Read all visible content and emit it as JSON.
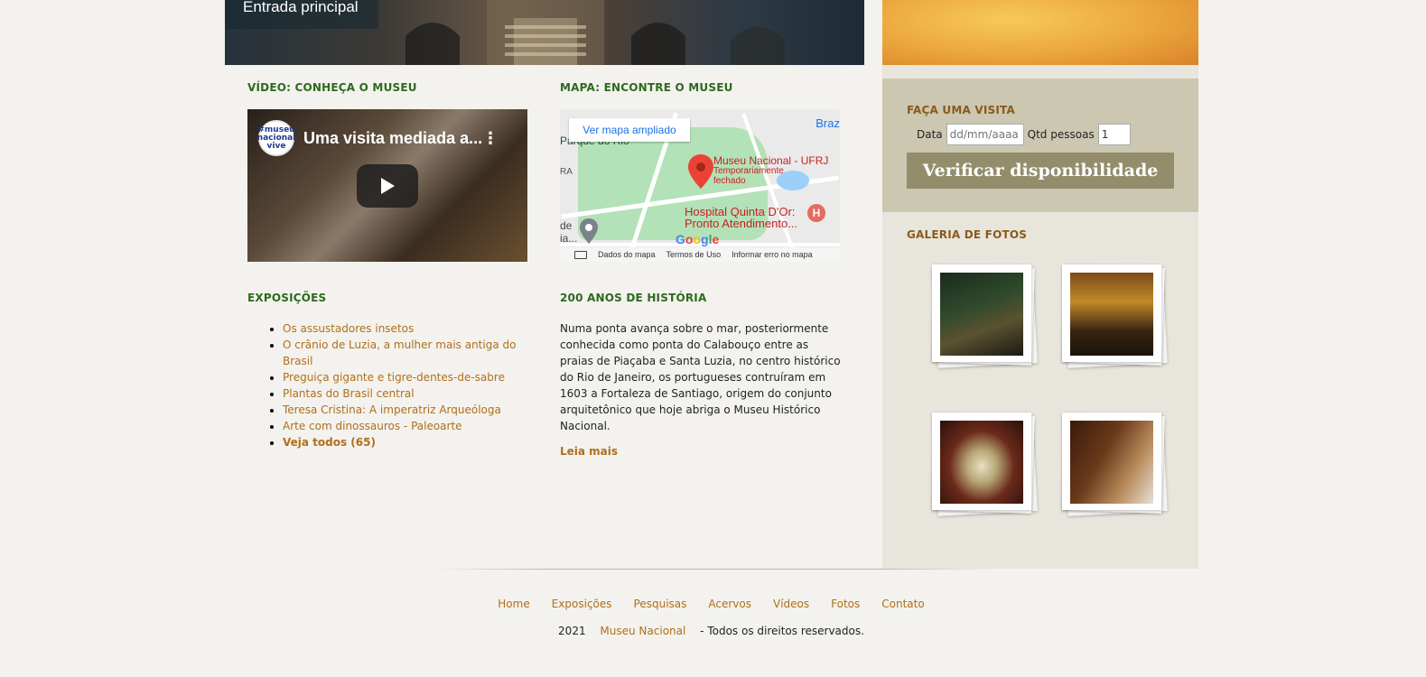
{
  "hero": {
    "caption": "Entrada principal"
  },
  "video": {
    "section_title": "VÍDEO: CONHEÇA O MUSEU",
    "channel_logo_text": "#museu nacional vive",
    "title": "Uma visita mediada a...",
    "menu_icon": "more-vert-icon",
    "play_icon": "play-icon"
  },
  "map": {
    "section_title": "MAPA: ENCONTRE O MUSEU",
    "open_larger": "Ver mapa ampliado",
    "labels": {
      "braz": "Braz",
      "park": "Parque do Rio",
      "ra": "RA",
      "museum": "Museu Nacional - UFRJ",
      "museum_status_1": "Temporariamente",
      "museum_status_2": "fechado",
      "hospital_1": "Hospital Quinta D'Or:",
      "hospital_2": "Pronto Atendimento...",
      "dia_1": "de",
      "dia_2": "ia..."
    },
    "google_logo": "Google",
    "footer": {
      "map_data": "Dados do mapa",
      "terms": "Termos de Uso",
      "report": "Informar erro no mapa"
    },
    "colors": {
      "park": "#b3e1b8",
      "pin": "#ea4335",
      "link": "#1a73e8"
    }
  },
  "exposicoes": {
    "section_title": "EXPOSIÇÕES",
    "items": [
      "Os assustadores insetos",
      "O crânio de Luzia, a mulher mais antiga do Brasil",
      "Preguiça gigante e tigre-dentes-de-sabre",
      "Plantas do Brasil central",
      "Teresa Cristina: A imperatriz Arqueóloga",
      "Arte com dinossauros - Paleoarte"
    ],
    "see_all": "Veja todos (65)"
  },
  "historia": {
    "section_title": "200 ANOS DE HISTÓRIA",
    "text": "Numa ponta avança sobre o mar, posteriormente conhecida como ponta do Calabouço entre as praias de Piaçaba e Santa Luzia, no centro histórico do Rio de Janeiro, os portugueses contruíram em 1603 a Fortaleza de Santiago, origem do conjunto arquitetônico que hoje abriga o Museu Histórico Nacional.",
    "read_more": "Leia mais"
  },
  "visita": {
    "title": "FAÇA UMA VISITA",
    "date_label": "Data",
    "date_placeholder": "dd/mm/aaaa",
    "qty_label": "Qtd pessoas",
    "qty_value": "1",
    "button": "Verificar disponibilidade"
  },
  "galeria": {
    "title": "GALERIA DE FOTOS",
    "photo_count": 4
  },
  "footer": {
    "nav": [
      "Home",
      "Exposições",
      "Pesquisas",
      "Acervos",
      "Vídeos",
      "Fotos",
      "Contato"
    ],
    "year": "2021",
    "brand": "Museu Nacional",
    "rights": "- Todos os direitos reservados."
  },
  "colors": {
    "background": "#f3f2ee",
    "section_title": "#2d6a1e",
    "link": "#b06f1a",
    "sidebar": "#e8e5dc",
    "visit_box": "#cbc7b1",
    "button": "#948d6c",
    "sidebar_title": "#8a5a1a"
  }
}
